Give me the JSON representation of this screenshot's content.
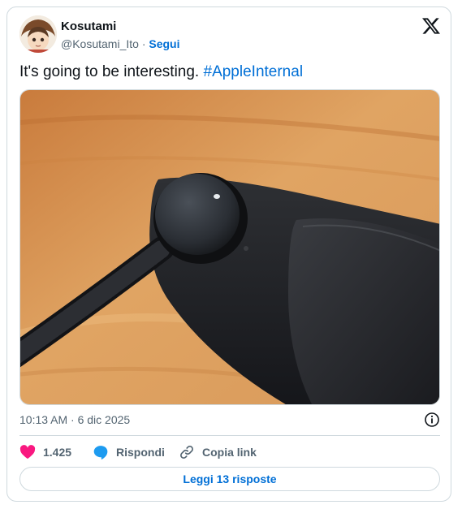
{
  "author": {
    "name": "Kosutami",
    "handle": "@Kosutami_Ito",
    "separator": "·",
    "follow_label": "Segui"
  },
  "platform_icon": "x-logo-icon",
  "tweet": {
    "text": "It's going to be interesting.",
    "hashtag": "#AppleInternal"
  },
  "media": {
    "icon": "photo"
  },
  "meta": {
    "timestamp": "10:13 AM · 6 dic 2025",
    "info_icon": "info-icon"
  },
  "actions": {
    "likes_count": "1.425",
    "reply_label": "Rispondi",
    "copy_link_label": "Copia link"
  },
  "read_replies_label": "Leggi 13 risposte",
  "colors": {
    "link_blue": "#006fd6",
    "like_pink": "#f91880",
    "reply_blue": "#1d9bf0",
    "text_primary": "#0f1419",
    "text_secondary": "#536471",
    "border": "#cfd9de"
  }
}
